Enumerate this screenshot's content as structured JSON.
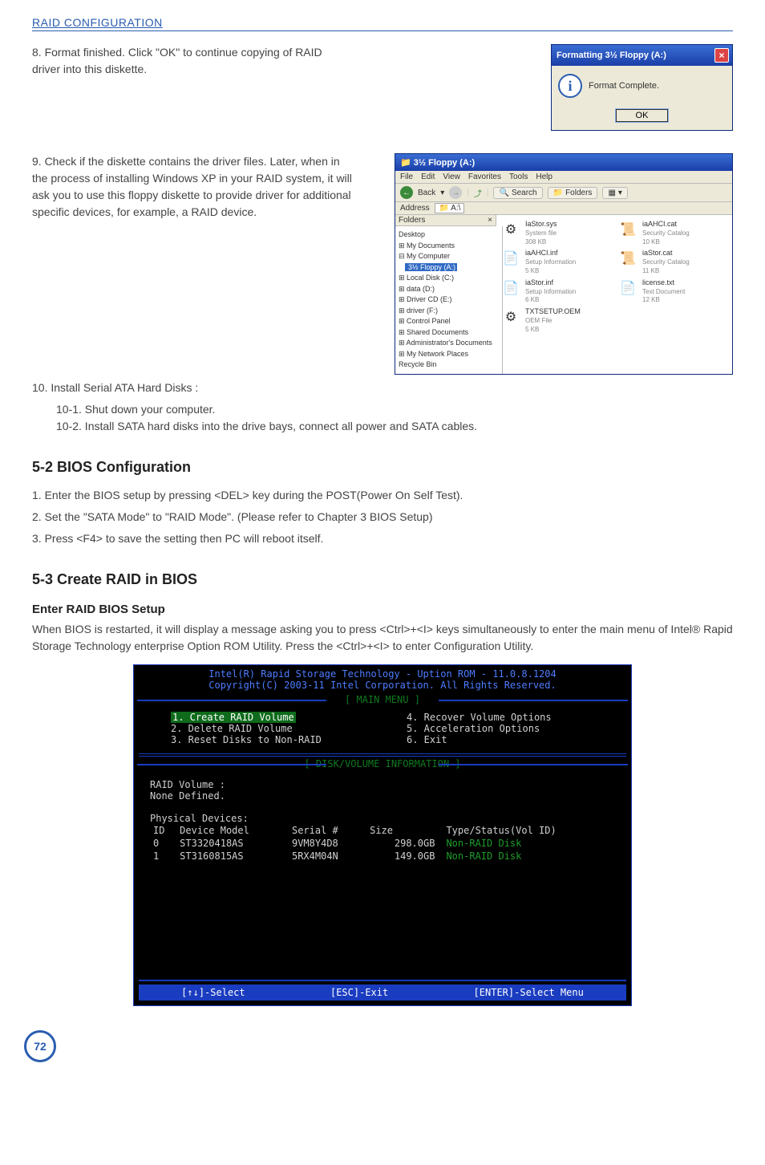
{
  "header": {
    "title": "RAID CONFIGURATION"
  },
  "steps": {
    "s8": "8. Format finished. Click \"OK\" to continue copying of RAID driver into this diskette.",
    "s9": "9. Check if the diskette contains the driver files. Later, when in the process of installing Windows XP in your RAID system, it will ask you to use this floppy diskette to provide driver for additional specific devices, for example, a RAID device.",
    "s10": "10. Install Serial ATA Hard Disks :",
    "s10_1": "10-1. Shut down your computer.",
    "s10_2": "10-2. Install SATA hard disks into the drive bays, connect all power and SATA cables."
  },
  "dialog": {
    "title": "Formatting 3½ Floppy (A:)",
    "message": "Format Complete.",
    "ok": "OK"
  },
  "explorer": {
    "title": "3½ Floppy (A:)",
    "menu": [
      "File",
      "Edit",
      "View",
      "Favorites",
      "Tools",
      "Help"
    ],
    "toolbar": {
      "back": "Back",
      "search": "Search",
      "folders": "Folders"
    },
    "address_label": "Address",
    "address_value": "A:\\",
    "folders_hdr": "Folders",
    "close_x": "×",
    "tree": [
      "Desktop",
      "⊞ My Documents",
      "⊟ My Computer",
      "   3½ Floppy (A:)",
      "  ⊞ Local Disk (C:)",
      "  ⊞ data (D:)",
      "  ⊞ Driver CD (E:)",
      "  ⊞ driver (F:)",
      "  ⊞ Control Panel",
      "  ⊞ Shared Documents",
      "  ⊞ Administrator's Documents",
      "⊞ My Network Places",
      "  Recycle Bin"
    ],
    "files": [
      {
        "name": "IaStor.sys",
        "type": "System file",
        "size": "308 KB",
        "icon": "⚙"
      },
      {
        "name": "iaAHCI.cat",
        "type": "Security Catalog",
        "size": "10 KB",
        "icon": "📜"
      },
      {
        "name": "iaAHCI.inf",
        "type": "Setup Information",
        "size": "5 KB",
        "icon": "📄"
      },
      {
        "name": "iaStor.cat",
        "type": "Security Catalog",
        "size": "11 KB",
        "icon": "📜"
      },
      {
        "name": "iaStor.inf",
        "type": "Setup Information",
        "size": "6 KB",
        "icon": "📄"
      },
      {
        "name": "license.txt",
        "type": "Text Document",
        "size": "12 KB",
        "icon": "📄"
      },
      {
        "name": "TXTSETUP.OEM",
        "type": "OEM File",
        "size": "5 KB",
        "icon": "⚙"
      }
    ]
  },
  "sec52": {
    "title": "5-2 BIOS Configuration",
    "p1": "1. Enter the BIOS setup by pressing <DEL> key during the POST(Power On Self Test).",
    "p2": "2. Set the \"SATA Mode\" to \"RAID Mode\". (Please refer to Chapter 3 BIOS Setup)",
    "p3": "3. Press <F4> to save the setting then PC will reboot itself."
  },
  "sec53": {
    "title": "5-3 Create RAID in BIOS",
    "sub": "Enter RAID BIOS Setup",
    "para": "When BIOS is restarted, it will display a message asking you to press <Ctrl>+<I> keys simultaneously to enter the main menu of Intel® Rapid Storage Technology enterprise Option ROM Utility. Press the <Ctrl>+<I> to enter Configuration Utility."
  },
  "bios": {
    "hdr1": "Intel(R) Rapid Storage Technology  -  Uption ROM - 11.0.8.1204",
    "hdr2": "Copyright(C) 2003-11 Intel Corporation.  All Rights Reserved.",
    "main_menu_label": "[ MAIN MENU ]",
    "menu_left": [
      "1. Create RAID Volume",
      "2. Delete RAID Volume",
      "3. Reset Disks to Non-RAID"
    ],
    "menu_right": [
      "4. Recover Volume Options",
      "5. Acceleration Options",
      "6. Exit"
    ],
    "info_label": "[ DISK/VOLUME INFORMATION ]",
    "raid_label": "RAID Volume :",
    "none_defined": "None Defined.",
    "phys_label": "Physical Devices:",
    "cols": {
      "id": "ID",
      "model": "Device Model",
      "serial": "Serial #",
      "size": "Size",
      "status": "Type/Status(Vol ID)"
    },
    "rows": [
      {
        "id": "0",
        "model": "ST3320418AS",
        "serial": "9VM8Y4D8",
        "size": "298.0GB",
        "status": "Non-RAID Disk"
      },
      {
        "id": "1",
        "model": "ST3160815AS",
        "serial": "5RX4M04N",
        "size": "149.0GB",
        "status": "Non-RAID Disk"
      }
    ],
    "footer": {
      "select": "[↑↓]-Select",
      "esc": "[ESC]-Exit",
      "enter": "[ENTER]-Select Menu"
    }
  },
  "page_number": "72"
}
